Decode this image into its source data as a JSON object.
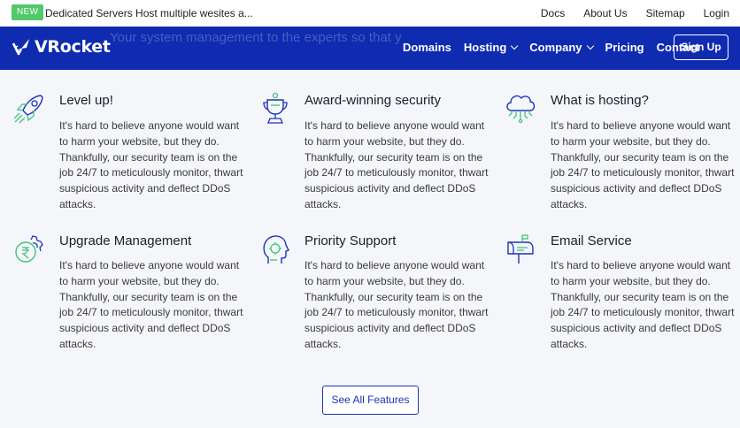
{
  "topbar": {
    "badge": "NEW",
    "promo": "Dedicated Servers Host multiple wesites a...",
    "links": [
      "Docs",
      "About Us",
      "Sitemap",
      "Login"
    ]
  },
  "navbar": {
    "ghost_text": "Your system management to the experts so that y",
    "logo_text": "VRocket",
    "items": [
      {
        "label": "Domains",
        "dropdown": false
      },
      {
        "label": "Hosting",
        "dropdown": true
      },
      {
        "label": "Company",
        "dropdown": true
      },
      {
        "label": "Pricing",
        "dropdown": false
      },
      {
        "label": "Contact",
        "dropdown": false
      }
    ],
    "signup": "Sign Up"
  },
  "features": [
    {
      "title": "Level up!",
      "icon": "rocket-icon",
      "desc": "It's hard to believe anyone would want to harm your website, but they do. Thankfully, our security team is on the job 24/7 to meticulously monitor, thwart suspicious activity and deflect DDoS attacks."
    },
    {
      "title": "Award-winning security",
      "icon": "trophy-icon",
      "desc": "It's hard to believe anyone would want to harm your website, but they do. Thankfully, our security team is on the job 24/7 to meticulously monitor, thwart suspicious activity and deflect DDoS attacks."
    },
    {
      "title": "What is hosting?",
      "icon": "cloud-icon",
      "desc": "It's hard to believe anyone would want to harm your website, but they do. Thankfully, our security team is on the job 24/7 to meticulously monitor, thwart suspicious activity and deflect DDoS attacks."
    },
    {
      "title": "Upgrade Management",
      "icon": "rupee-gear-icon",
      "desc": "It's hard to believe anyone would want to harm your website, but they do. Thankfully, our security team is on the job 24/7 to meticulously monitor, thwart suspicious activity and deflect DDoS attacks."
    },
    {
      "title": "Priority Support",
      "icon": "support-head-icon",
      "desc": "It's hard to believe anyone would want to harm your website, but they do. Thankfully, our security team is on the job 24/7 to meticulously monitor, thwart suspicious activity and deflect DDoS attacks."
    },
    {
      "title": "Email Service",
      "icon": "mailbox-icon",
      "desc": "It's hard to believe anyone would want to harm your website, but they do. Thankfully, our security team is on the job 24/7 to meticulously monitor, thwart suspicious activity and deflect DDoS attacks."
    }
  ],
  "cta": "See All Features",
  "colors": {
    "nav_bg": "#0f2bb0",
    "badge": "#52c96a",
    "icon_green": "#3cc47a",
    "icon_blue": "#1b33b8"
  }
}
